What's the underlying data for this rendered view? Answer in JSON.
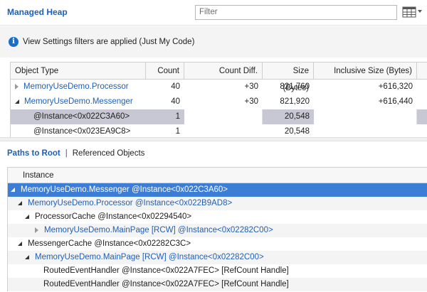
{
  "header": {
    "title": "Managed Heap",
    "filter_placeholder": "Filter"
  },
  "info": {
    "message": "View Settings filters are applied (Just My Code)"
  },
  "object_table": {
    "columns": [
      "Object Type",
      "Count",
      "Count Diff.",
      "Size (Bytes)",
      "Inclusive Size (Bytes)"
    ],
    "rows": [
      {
        "name": "MemoryUseDemo.Processor",
        "count": "40",
        "count_diff": "+30",
        "size": "821,760",
        "inclusive": "+616,320"
      },
      {
        "name": "MemoryUseDemo.Messenger",
        "count": "40",
        "count_diff": "+30",
        "size": "821,920",
        "inclusive": "+616,440"
      },
      {
        "name": "@Instance<0x022C3A60>",
        "count": "1",
        "count_diff": "",
        "size": "20,548",
        "inclusive": ""
      },
      {
        "name": "@Instance<0x023EA9C8>",
        "count": "1",
        "count_diff": "",
        "size": "20,548",
        "inclusive": ""
      }
    ]
  },
  "tabs": {
    "active": "Paths to Root",
    "separator": "|",
    "inactive": "Referenced Objects"
  },
  "paths": {
    "header": "Instance",
    "rows": [
      {
        "type": "MemoryUseDemo.Messenger",
        "rest": "@Instance<0x022C3A60>"
      },
      {
        "type": "MemoryUseDemo.Processor",
        "rest": "@Instance<0x022B9AD8>"
      },
      {
        "type": "",
        "rest": "ProcessorCache @Instance<0x02294540>"
      },
      {
        "type": "MemoryUseDemo.MainPage [RCW]",
        "rest": "@Instance<0x02282C00>"
      },
      {
        "type": "",
        "rest": "MessengerCache @Instance<0x02282C3C>"
      },
      {
        "type": "MemoryUseDemo.MainPage [RCW]",
        "rest": "@Instance<0x02282C00>"
      },
      {
        "type": "",
        "rest": "RoutedEventHandler @Instance<0x022A7FEC> [RefCount Handle]"
      },
      {
        "type": "",
        "rest": "RoutedEventHandler @Instance<0x022A7FEC> [RefCount Handle]"
      }
    ]
  },
  "icons": {
    "filter_view": "grid-icon",
    "info": "info-icon"
  },
  "colors": {
    "link": "#1e5fb8",
    "selection_blue": "#3c7ed6",
    "selection_gray": "#c8c8d4"
  }
}
